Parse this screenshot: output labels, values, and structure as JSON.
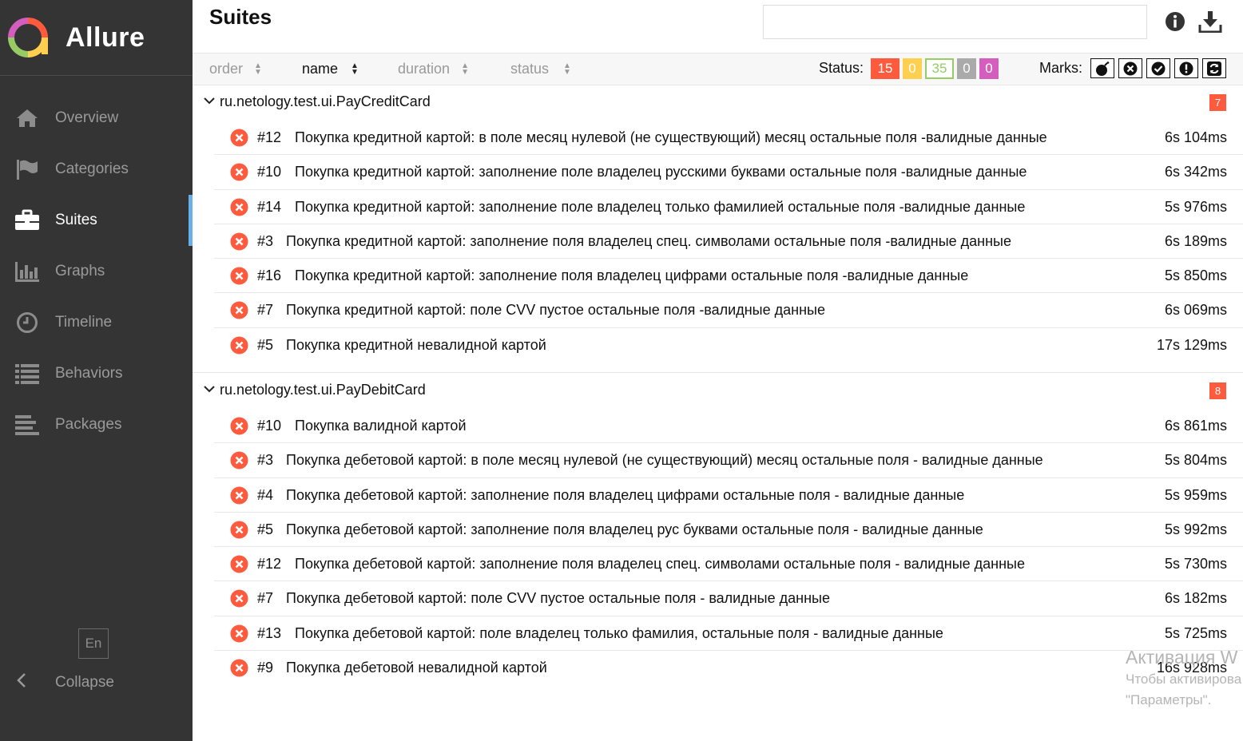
{
  "app": {
    "name": "Allure"
  },
  "colors": {
    "failed": "#fd5a3e",
    "broken": "#ffd050",
    "passed": "#97cc64",
    "skipped": "#aaaaaa",
    "unknown": "#d35ebe",
    "accent": "#6ab0e8"
  },
  "sidebar": {
    "items": [
      {
        "label": "Overview",
        "icon": "home-icon"
      },
      {
        "label": "Categories",
        "icon": "flag-icon"
      },
      {
        "label": "Suites",
        "icon": "briefcase-icon",
        "active": true
      },
      {
        "label": "Graphs",
        "icon": "bar-chart-icon"
      },
      {
        "label": "Timeline",
        "icon": "clock-icon"
      },
      {
        "label": "Behaviors",
        "icon": "list-icon"
      },
      {
        "label": "Packages",
        "icon": "align-left-icon"
      }
    ],
    "lang": "En",
    "collapse": "Collapse"
  },
  "header": {
    "title": "Suites",
    "search_value": ""
  },
  "toolbar": {
    "sort": [
      {
        "label": "order"
      },
      {
        "label": "name",
        "active": true
      },
      {
        "label": "duration"
      },
      {
        "label": "status"
      }
    ],
    "status_label": "Status:",
    "status_counts": {
      "failed": "15",
      "broken": "0",
      "passed": "35",
      "skipped": "0",
      "unknown": "0"
    },
    "marks_label": "Marks:"
  },
  "suites": [
    {
      "name": "ru.netology.test.ui.PayCreditCard",
      "count": "7",
      "tests": [
        {
          "num": "#12",
          "name": "Покупка кредитной картой: в поле месяц нулевой (не существующий) месяц остальные поля -валидные данные",
          "duration": "6s 104ms"
        },
        {
          "num": "#10",
          "name": "Покупка кредитной картой: заполнение поле владелец русскими буквами остальные поля -валидные данные",
          "duration": "6s 342ms"
        },
        {
          "num": "#14",
          "name": "Покупка кредитной картой: заполнение поле владелец только фамилией остальные поля -валидные данные",
          "duration": "5s 976ms"
        },
        {
          "num": "#3",
          "name": "Покупка кредитной картой: заполнение поля владелец спец. символами остальные поля -валидные данные",
          "duration": "6s 189ms"
        },
        {
          "num": "#16",
          "name": "Покупка кредитной картой: заполнение поля владелец цифрами остальные поля -валидные данные",
          "duration": "5s 850ms"
        },
        {
          "num": "#7",
          "name": "Покупка кредитной картой: поле CVV пустое остальные поля -валидные данные",
          "duration": "6s 069ms"
        },
        {
          "num": "#5",
          "name": "Покупка кредитной невалидной картой",
          "duration": "17s 129ms"
        }
      ]
    },
    {
      "name": "ru.netology.test.ui.PayDebitCard",
      "count": "8",
      "tests": [
        {
          "num": "#10",
          "name": "Покупка валидной картой",
          "duration": "6s 861ms"
        },
        {
          "num": "#3",
          "name": "Покупка дебетовой картой: в поле месяц нулевой (не существующий) месяц остальные поля - валидные данные",
          "duration": "5s 804ms"
        },
        {
          "num": "#4",
          "name": "Покупка дебетовой картой: заполнение поля владелец цифрами остальные поля - валидные данные",
          "duration": "5s 959ms"
        },
        {
          "num": "#5",
          "name": "Покупка дебетовой картой: заполнение поля владелец рус буквами остальные поля - валидные данные",
          "duration": "5s 992ms"
        },
        {
          "num": "#12",
          "name": "Покупка дебетовой картой: заполнение поля владелец спец. символами остальные поля - валидные данные",
          "duration": "5s 730ms"
        },
        {
          "num": "#7",
          "name": "Покупка дебетовой картой: поле CVV пустое остальные поля - валидные данные",
          "duration": "6s 182ms"
        },
        {
          "num": "#13",
          "name": "Покупка дебетовой картой: поле владелец только фамилия, остальные поля - валидные данные",
          "duration": "5s 725ms"
        },
        {
          "num": "#9",
          "name": "Покупка дебетовой невалидной картой",
          "duration": "16s 928ms"
        }
      ]
    }
  ],
  "watermark": {
    "line1": "Активация W",
    "line2": "Чтобы активирова",
    "line3": "\"Параметры\"."
  }
}
